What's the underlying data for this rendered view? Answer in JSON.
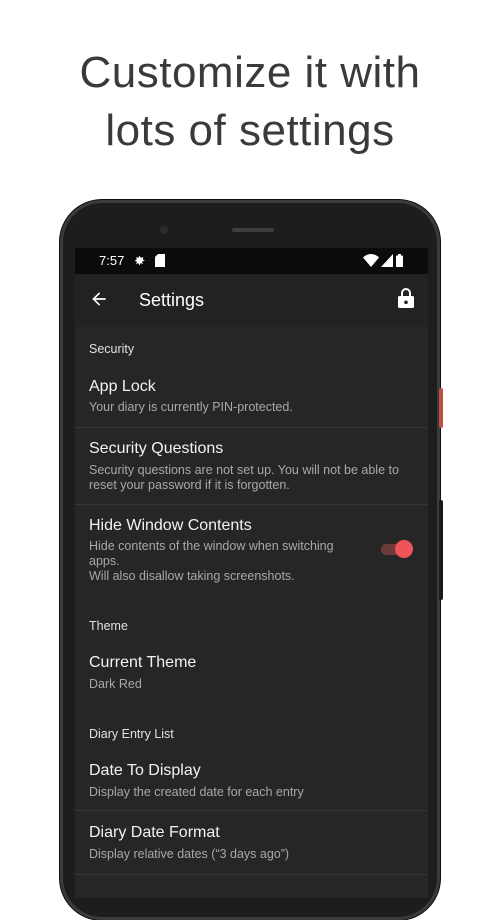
{
  "headline": {
    "line1": "Customize it with",
    "line2": "lots of settings"
  },
  "status_bar": {
    "time": "7:57",
    "icons": [
      "gear-icon",
      "sd-card-icon",
      "wifi-icon",
      "signal-icon",
      "battery-icon"
    ]
  },
  "app_bar": {
    "title": "Settings",
    "back_icon": "back-arrow-icon",
    "action_icon": "lock-icon"
  },
  "sections": [
    {
      "header": "Security",
      "items": [
        {
          "title": "App Lock",
          "summary": "Your diary is currently PIN-protected."
        },
        {
          "title": "Security Questions",
          "summary": "Security questions are not set up. You will not be able to reset your password if it is forgotten."
        },
        {
          "title": "Hide Window Contents",
          "summary": "Hide contents of the window when switching apps.\nWill also disallow taking screenshots.",
          "switch_on": true
        }
      ]
    },
    {
      "header": "Theme",
      "items": [
        {
          "title": "Current Theme",
          "summary": "Dark Red"
        }
      ]
    },
    {
      "header": "Diary Entry List",
      "items": [
        {
          "title": "Date To Display",
          "summary": "Display the created date for each entry"
        },
        {
          "title": "Diary Date Format",
          "summary": "Display relative dates (“3 days ago”)"
        }
      ]
    }
  ],
  "colors": {
    "screen_bg": "#262626",
    "app_bar": "#222222",
    "accent": "#f0545a",
    "summary_text": "#a8a8a8"
  }
}
